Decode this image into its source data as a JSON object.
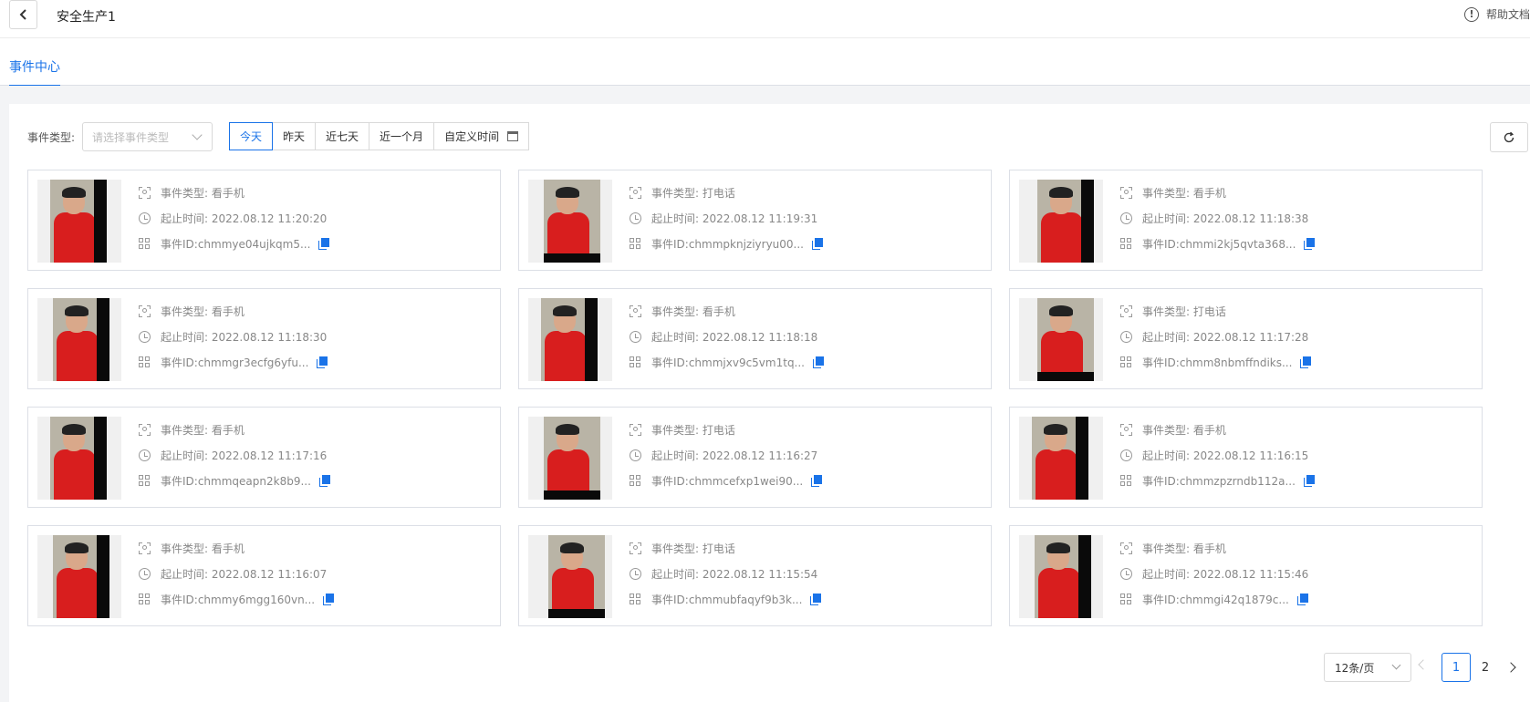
{
  "header": {
    "title": "安全生产1",
    "help_label": "帮助文档",
    "help_icon": "alert-circle-icon"
  },
  "tabs": [
    {
      "label": "事件中心",
      "active": true
    }
  ],
  "filters": {
    "event_type_label": "事件类型:",
    "event_type_placeholder": "请选择事件类型",
    "date_options": [
      {
        "label": "今天",
        "active": true
      },
      {
        "label": "昨天",
        "active": false
      },
      {
        "label": "近七天",
        "active": false
      },
      {
        "label": "近一个月",
        "active": false
      },
      {
        "label": "自定义时间",
        "active": false
      }
    ]
  },
  "colors": {
    "accent": "#1a73e8",
    "border": "#dcdfe6",
    "muted_text": "#888888",
    "background": "#f3f4f6"
  },
  "events": [
    {
      "type": "事件类型: 看手机",
      "time": "起止时间: 2022.08.12 11:20:20",
      "id": "事件ID:chmmye04ujkqm5..."
    },
    {
      "type": "事件类型: 打电话",
      "time": "起止时间: 2022.08.12 11:19:31",
      "id": "事件ID:chmmpknjziyryu00..."
    },
    {
      "type": "事件类型: 看手机",
      "time": "起止时间: 2022.08.12 11:18:38",
      "id": "事件ID:chmmi2kj5qvta368..."
    },
    {
      "type": "事件类型: 看手机",
      "time": "起止时间: 2022.08.12 11:18:30",
      "id": "事件ID:chmmgr3ecfg6yfu..."
    },
    {
      "type": "事件类型: 看手机",
      "time": "起止时间: 2022.08.12 11:18:18",
      "id": "事件ID:chmmjxv9c5vm1tq..."
    },
    {
      "type": "事件类型: 打电话",
      "time": "起止时间: 2022.08.12 11:17:28",
      "id": "事件ID:chmm8nbmffndiks..."
    },
    {
      "type": "事件类型: 看手机",
      "time": "起止时间: 2022.08.12 11:17:16",
      "id": "事件ID:chmmqeapn2k8b9..."
    },
    {
      "type": "事件类型: 打电话",
      "time": "起止时间: 2022.08.12 11:16:27",
      "id": "事件ID:chmmcefxp1wei90..."
    },
    {
      "type": "事件类型: 看手机",
      "time": "起止时间: 2022.08.12 11:16:15",
      "id": "事件ID:chmmzpzrndb112a..."
    },
    {
      "type": "事件类型: 看手机",
      "time": "起止时间: 2022.08.12 11:16:07",
      "id": "事件ID:chmmy6mgg160vn..."
    },
    {
      "type": "事件类型: 打电话",
      "time": "起止时间: 2022.08.12 11:15:54",
      "id": "事件ID:chmmubfaqyf9b3k..."
    },
    {
      "type": "事件类型: 看手机",
      "time": "起止时间: 2022.08.12 11:15:46",
      "id": "事件ID:chmmgi42q1879c..."
    }
  ],
  "pagination": {
    "page_size_label": "12条/页",
    "pages": [
      "1",
      "2"
    ],
    "current_page": "1"
  }
}
